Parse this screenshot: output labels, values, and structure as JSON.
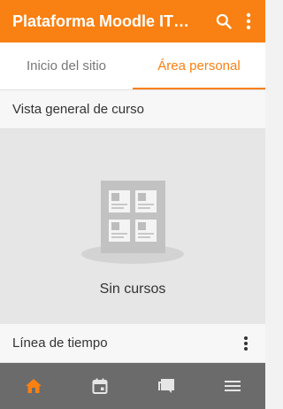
{
  "appbar": {
    "title": "Plataforma Moodle IT…",
    "search_icon": "search-icon",
    "more_icon": "more-vert-icon"
  },
  "tabs": [
    {
      "label": "Inicio del sitio",
      "active": false
    },
    {
      "label": "Área personal",
      "active": true
    }
  ],
  "course_overview": {
    "header": "Vista general de curso",
    "empty_text": "Sin cursos"
  },
  "timeline": {
    "header": "Línea de tiempo",
    "more_icon": "more-vert-icon"
  },
  "bottom_nav": [
    {
      "name": "home-icon",
      "active": true
    },
    {
      "name": "calendar-icon",
      "active": false
    },
    {
      "name": "messages-icon",
      "active": false
    },
    {
      "name": "menu-icon",
      "active": false
    }
  ],
  "colors": {
    "accent": "#f98012",
    "bottom_nav_bg": "#6b6b6b",
    "bottom_nav_icon": "#e6e6e6"
  }
}
